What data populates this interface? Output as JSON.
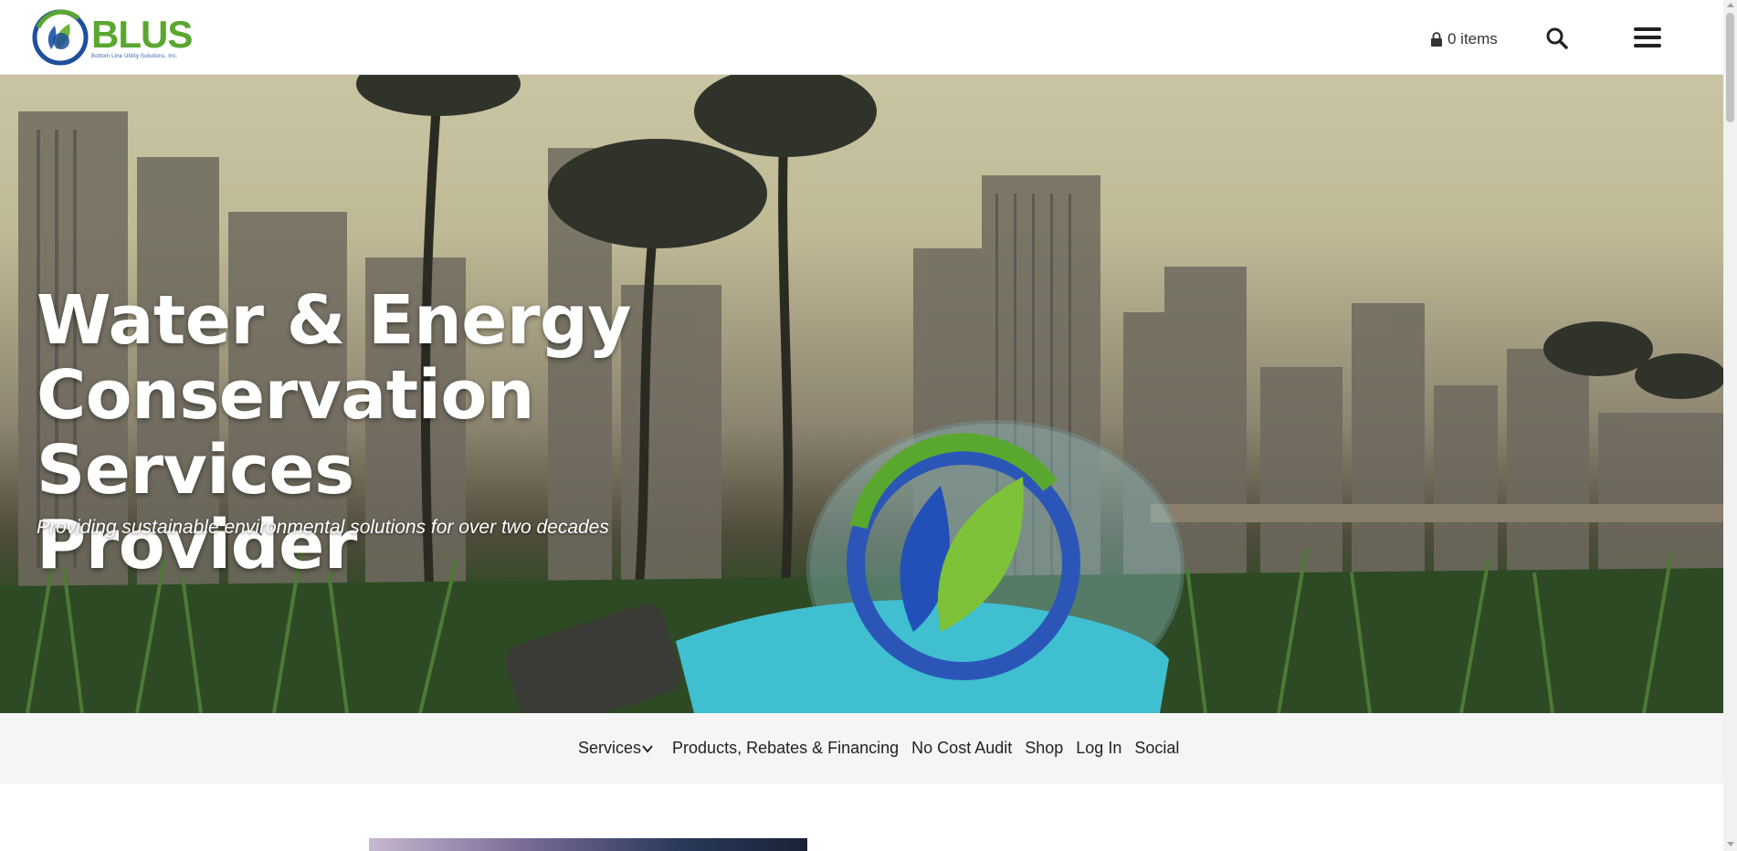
{
  "header": {
    "logo_text": "BLUS",
    "logo_subtitle": "Bottom Line Utility Solutions, Inc.",
    "cart_label": "0 items",
    "search_icon": "search-icon",
    "menu_icon": "hamburger-menu-icon"
  },
  "hero": {
    "title_line1": "Water & Energy",
    "title_line2": "Conservation Services",
    "title_line3": "Provider",
    "subtitle": "Providing sustainable environmental solutions for over two decades"
  },
  "nav": {
    "items": [
      {
        "label": "Services",
        "has_dropdown": true
      },
      {
        "label": "Products, Rebates & Financing"
      },
      {
        "label": "No Cost Audit"
      },
      {
        "label": "Shop"
      },
      {
        "label": "Log In"
      },
      {
        "label": "Social"
      }
    ]
  },
  "colors": {
    "brand_green": "#5aa72f",
    "brand_blue": "#2e63b0",
    "nav_bg": "#f5f5f5"
  }
}
